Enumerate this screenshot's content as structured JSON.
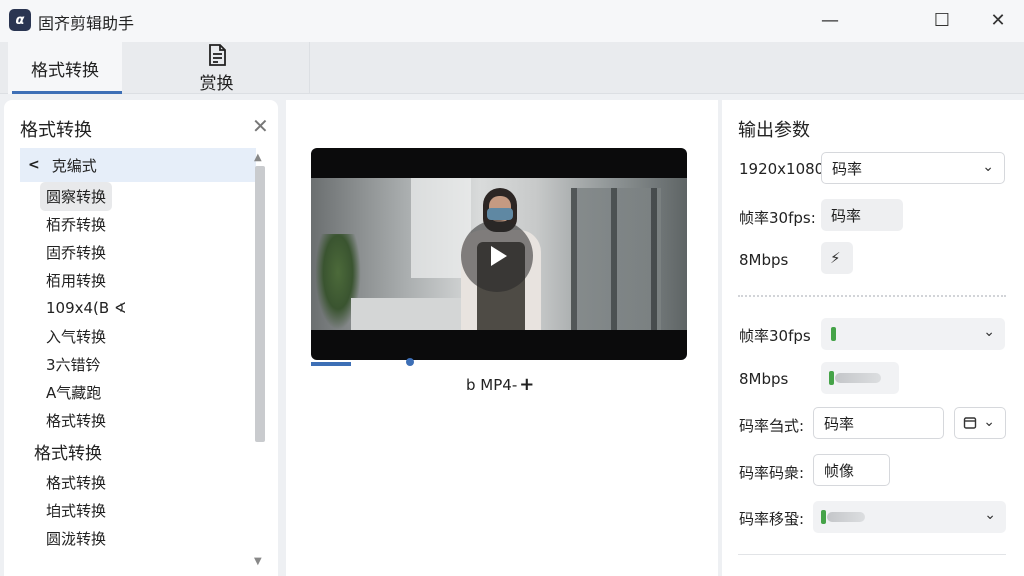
{
  "window": {
    "title": "固齐剪辑助手",
    "app_icon": "α",
    "controls": {
      "minimize": "—",
      "maximize": "☐",
      "close": "✕"
    }
  },
  "tabs": [
    {
      "label": "格式转换",
      "active": true
    },
    {
      "label": "赏换",
      "icon": "document-icon"
    }
  ],
  "sidebar": {
    "title": "格式转换",
    "close_glyph": "✕",
    "expanded_header": "克编式",
    "items": [
      {
        "label": "圆察转换",
        "selected": true
      },
      {
        "label": "栢乔转换"
      },
      {
        "label": "固乔转换"
      },
      {
        "label": "栢用转换"
      },
      {
        "label": "109x4(B ∢"
      },
      {
        "label": "入气转换"
      },
      {
        "label": "3六错钤"
      },
      {
        "label": "A气藏跑"
      },
      {
        "label": "格式转换"
      }
    ],
    "group_title": "格式转换",
    "group_items": [
      {
        "label": "格式转换"
      },
      {
        "label": "垍式转换"
      },
      {
        "label": "圆泷转换"
      }
    ]
  },
  "preview": {
    "format_label": "b MP4-",
    "add_glyph": "+",
    "progress": 0.11
  },
  "output": {
    "title": "输出参数",
    "resolution_label": "1920x1080",
    "resolution_select": "码率",
    "framerate_label": "帧率30fps:",
    "framerate_chip": "码率",
    "bitrate_label": "8Mbps",
    "bitrate_icon": "⚡",
    "framerate2_label": "帧率30fps",
    "bitrate2_label": "8Mbps",
    "ratemode_label": "码率刍式:",
    "ratemode_value": "码率",
    "ratecode_label": "码率码衆:",
    "ratecode_value": "帧像",
    "ratemove_label": "码率移蛩:",
    "accent_green": "#45a348"
  }
}
